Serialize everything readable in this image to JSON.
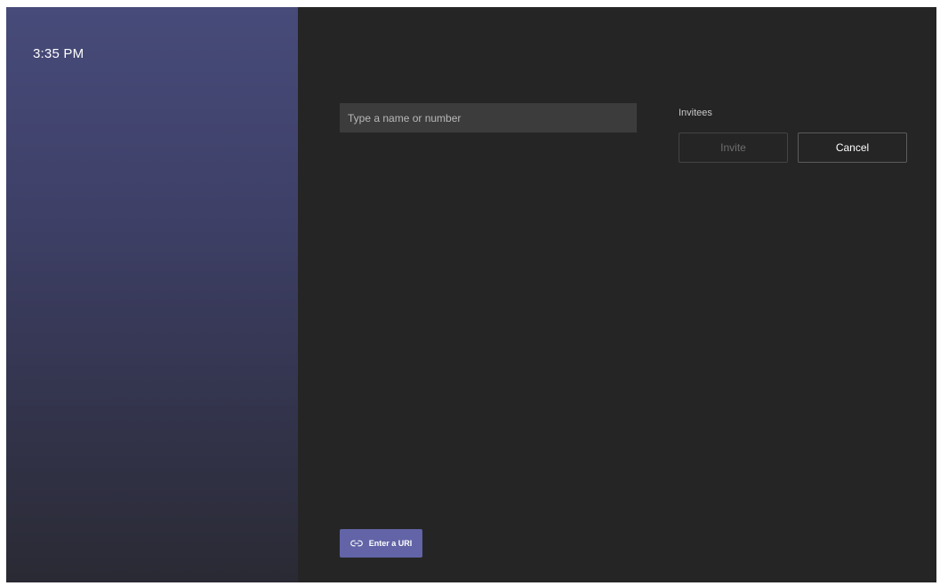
{
  "status": {
    "time": "3:35 PM"
  },
  "search": {
    "placeholder": "Type a name or number",
    "value": ""
  },
  "invitees": {
    "label": "Invitees"
  },
  "actions": {
    "invite_label": "Invite",
    "cancel_label": "Cancel",
    "enter_uri_label": "Enter a URI"
  },
  "icons": {
    "enter_uri": "link-icon"
  },
  "colors": {
    "accent": "#6264a7",
    "background": "#252525",
    "sidebar_top": "#474b79",
    "sidebar_bottom": "#2a2a34",
    "input_background": "#3c3c3c"
  }
}
